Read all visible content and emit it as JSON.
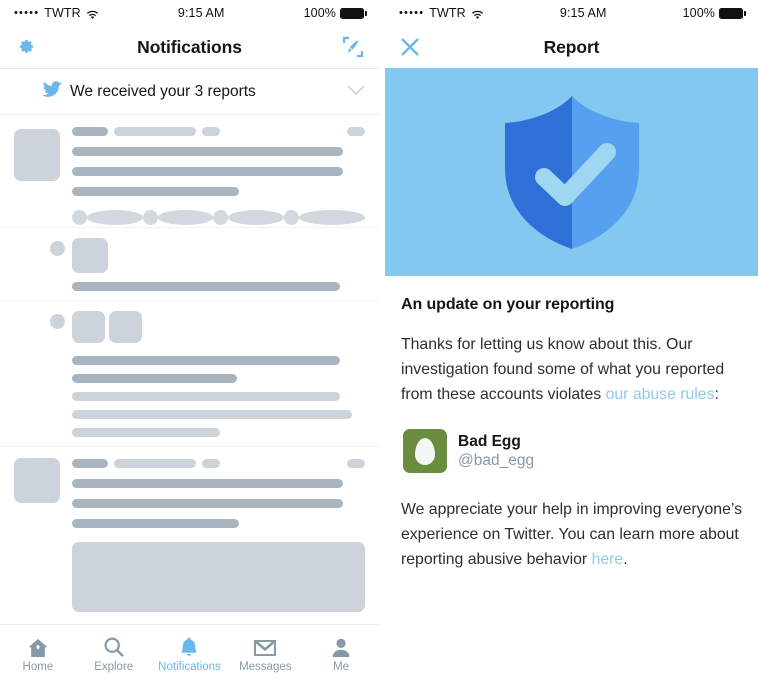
{
  "colors": {
    "twitter_blue": "#6ab7ec",
    "link_blue": "#8ec9ee",
    "hero_bg": "#83c8ef",
    "shield_dark": "#2f6fd8",
    "shield_light": "#57a0ef",
    "check": "#9fd6f2",
    "avatar_green": "#6a8c3f",
    "skeleton_dark": "#a9b4bf",
    "skeleton_light": "#ccd3da",
    "text_primary": "#14171a",
    "text_secondary": "#8899a6"
  },
  "left_screen": {
    "status_bar": {
      "carrier_dots": "•••••",
      "carrier": "TWTR",
      "wifi_icon": "wifi-icon",
      "time": "9:15 AM",
      "battery_percent": "100%",
      "battery_icon": "battery-full-icon"
    },
    "navbar": {
      "left_icon": "gear-icon",
      "title": "Notifications",
      "right_icon": "compose-icon"
    },
    "banner": {
      "icon": "twitter-bird-icon",
      "text": "We received your 3 reports",
      "chevron_icon": "chevron-down-icon"
    },
    "tabbar": {
      "tabs": [
        {
          "label": "Home",
          "icon": "home-icon",
          "active": false
        },
        {
          "label": "Explore",
          "icon": "search-icon",
          "active": false
        },
        {
          "label": "Notifications",
          "icon": "bell-icon",
          "active": true
        },
        {
          "label": "Messages",
          "icon": "envelope-icon",
          "active": false
        },
        {
          "label": "Me",
          "icon": "person-icon",
          "active": false
        }
      ]
    }
  },
  "right_screen": {
    "status_bar": {
      "carrier_dots": "•••••",
      "carrier": "TWTR",
      "wifi_icon": "wifi-icon",
      "time": "9:15 AM",
      "battery_percent": "100%",
      "battery_icon": "battery-full-icon"
    },
    "navbar": {
      "left_icon": "close-icon",
      "title": "Report"
    },
    "hero": {
      "icon": "shield-check-icon"
    },
    "heading": "An update on your reporting",
    "paragraph_1": {
      "before": "Thanks for letting us know about this. Our investigation found some of what you reported from these accounts violates ",
      "link": "our abuse rules",
      "after": ":"
    },
    "reported_account": {
      "avatar_icon": "egg-avatar-icon",
      "name": "Bad Egg",
      "handle": "@bad_egg"
    },
    "paragraph_2": {
      "before": "We appreciate your help in improving everyone’s experience on Twitter. You can learn more about reporting abusive behavior ",
      "link": "here",
      "after": "."
    }
  }
}
